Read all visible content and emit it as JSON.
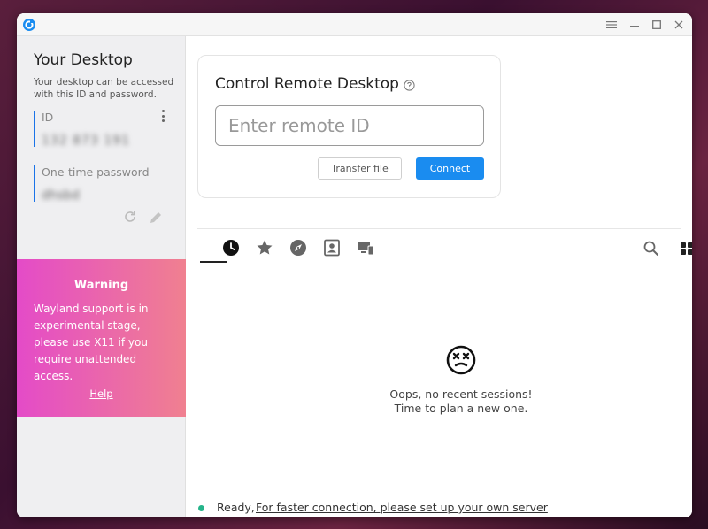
{
  "colors": {
    "accent": "#1a8cf0",
    "id_border": "#1a73e8",
    "warning_gradient_start": "#e44bc8",
    "warning_gradient_end": "#f08090",
    "status_ready": "#25b48a"
  },
  "titlebar": {
    "icons": [
      "app-logo-icon",
      "hamburger-icon",
      "minimize-icon",
      "maximize-icon",
      "close-icon"
    ]
  },
  "sidebar": {
    "title": "Your Desktop",
    "description": "Your desktop can be accessed with this ID and password.",
    "id_label": "ID",
    "id_value": "132 873 191",
    "password_label": "One-time password",
    "password_value": "dhsbd",
    "warning": {
      "title": "Warning",
      "text": "Wayland support is in experimental stage, please use X11 if you require unattended access.",
      "help": "Help"
    }
  },
  "control": {
    "title": "Control Remote Desktop",
    "input_placeholder": "Enter remote ID",
    "transfer_label": "Transfer file",
    "connect_label": "Connect"
  },
  "tabs": [
    {
      "icon": "history-icon",
      "active": true
    },
    {
      "icon": "star-icon",
      "active": false
    },
    {
      "icon": "compass-icon",
      "active": false
    },
    {
      "icon": "address-book-icon",
      "active": false
    },
    {
      "icon": "lan-devices-icon",
      "active": false
    }
  ],
  "sessions": {
    "empty_line1": "Oops, no recent sessions!",
    "empty_line2": "Time to plan a new one."
  },
  "status": {
    "ready": "Ready,",
    "link": "For faster connection, please set up your own server"
  }
}
